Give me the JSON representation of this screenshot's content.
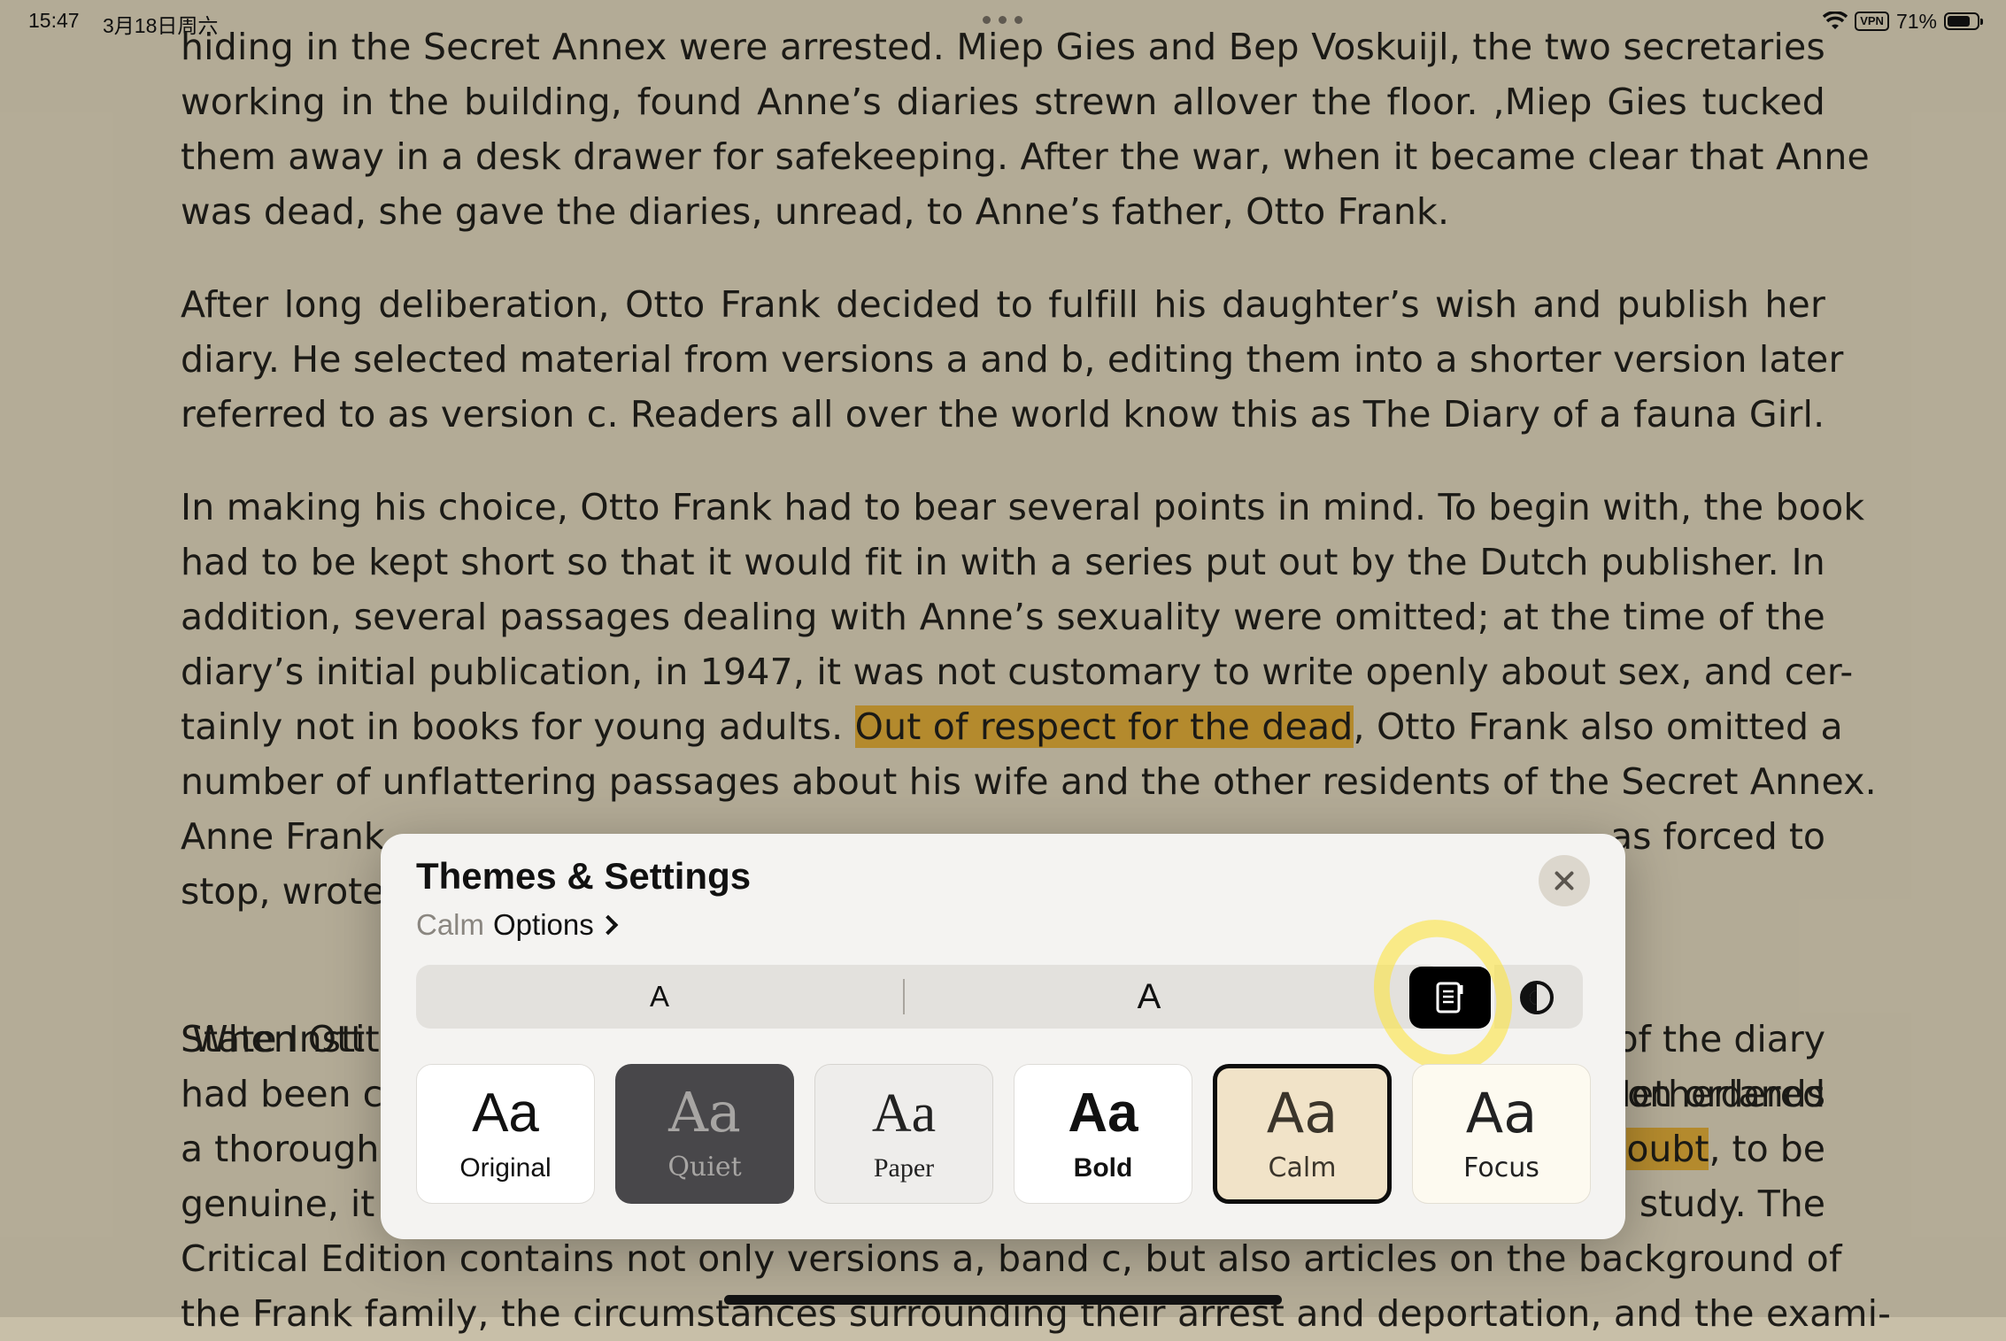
{
  "status_bar": {
    "time": "15:47",
    "date": "3月18日周六",
    "vpn": "VPN",
    "battery_percent": "71%",
    "battery_level": 0.71
  },
  "book_text": {
    "p1": [
      "hiding in the Secret Annex were arrested. Miep Gies and Bep Voskuijl, the two secretaries",
      "working in the building, found Anne’s diaries strewn allover the floor. ,Miep Gies tucked",
      "them away in a desk drawer for safekeeping. After the war, when it became clear that Anne",
      "was dead, she gave the diaries, unread, to Anne’s father, Otto Frank."
    ],
    "p2": [
      " After long deliberation, Otto Frank decided to fulfill his daughter’s wish and publish her",
      "diary. He selected material from versions a and b, editing them into a shorter version later",
      "referred to as version c. Readers all over the world know this as The Diary of a fauna Girl."
    ],
    "p3": [
      " In making his choice, Otto Frank had to bear several points in mind. To begin with, the book",
      "had to be kept short so that it would fit in with a series put out by the Dutch publisher. In",
      "addition, several passages dealing with Anne’s sexuality were omitted; at the time of the",
      "diary’s initial publication, in 1947, it was not customary to write openly about sex, and cer-"
    ],
    "p3_l5_before": "tainly not in books for young adults. ",
    "p3_l5_highlight": "Out of respect for the dead",
    "p3_l5_after": ", Otto Frank also omitted a",
    "p3_l6": "number of unflattering passages about his wife and the other residents of the Secret Annex.",
    "p3_l7_left": "Anne Frank",
    "p3_l7_right": "as forced to",
    "p3_l8_left": "stop, wrote",
    "p4_l1_left": " When Ott",
    "p4_l1_right": "Netherlands",
    "p4_l2_left": "State Institu",
    "p4_l2_right": "of the diary",
    "p4_l3_left": "had been c",
    "p4_l3_right": "on ordered",
    "p4_l4_left": "a thorough",
    "p4_l4_right_highlight": "oubt",
    "p4_l4_right_after": ", to be",
    "p4_l5_left": "genuine, it",
    "p4_l5_right": "study. The",
    "p4_l6": "Critical Edition contains not only versions a, band c, but also articles on the background of",
    "p4_l7": "the Frank family, the circumstances surrounding their arrest and deportation, and the exami-"
  },
  "panel": {
    "title": "Themes & Settings",
    "current_theme": "Calm",
    "options_label": "Options",
    "font_small": "A",
    "font_large": "A",
    "layout_button": "page-layout-icon",
    "contrast_button": "contrast-icon",
    "close": "close-icon"
  },
  "themes": [
    {
      "aa": "Aa",
      "name": "Original",
      "bg": "#ffffff"
    },
    {
      "aa": "Aa",
      "name": "Quiet",
      "bg": "#48474a"
    },
    {
      "aa": "Aa",
      "name": "Paper",
      "bg": "#eeedeb"
    },
    {
      "aa": "Aa",
      "name": "Bold",
      "bg": "#ffffff"
    },
    {
      "aa": "Aa",
      "name": "Calm",
      "bg": "#f1e3c8",
      "selected": true
    },
    {
      "aa": "Aa",
      "name": "Focus",
      "bg": "#fdfaf0"
    }
  ],
  "colors": {
    "page_bg": "#c8bfa8",
    "highlight": "#c99a33",
    "tap_marker": "#fce446"
  }
}
